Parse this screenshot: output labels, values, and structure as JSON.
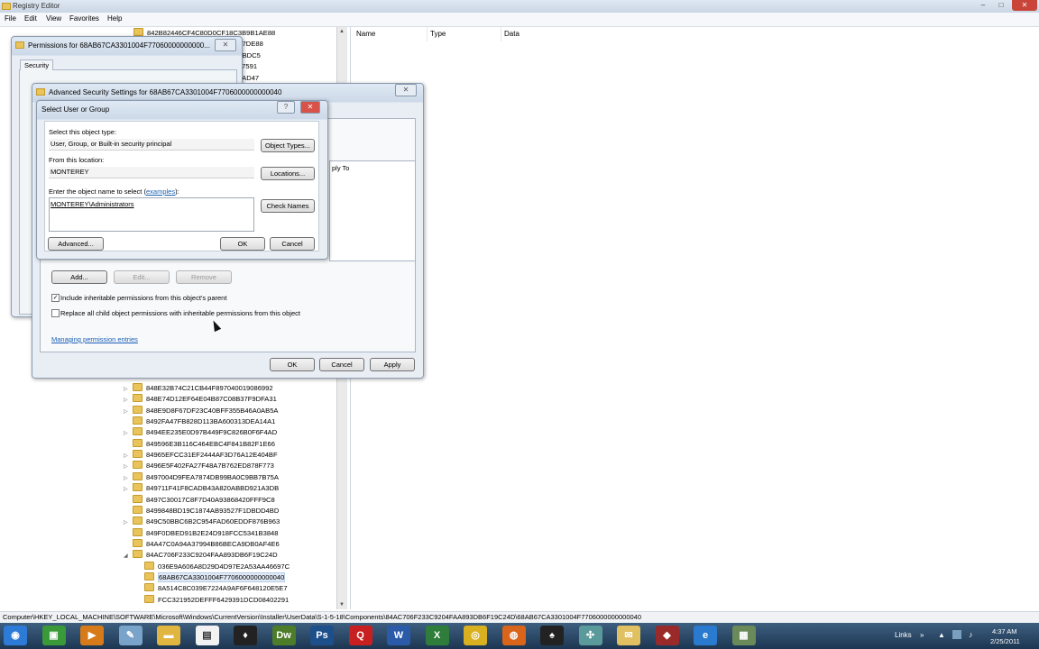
{
  "app": {
    "title": "Registry Editor",
    "controls": {
      "minimize": "–",
      "maximize": "□",
      "close": "✕"
    }
  },
  "menu": [
    "File",
    "Edit",
    "View",
    "Favorites",
    "Help"
  ],
  "tree": {
    "top_rows": [
      "842B82446CF4C80D0CF18C3B9B1AE88",
      "B47A7DE88",
      "BF2FBDC5",
      "024C7591",
      "BF13AD47"
    ],
    "rows": [
      {
        "label": "848E32B74C21CB44F897040019086992",
        "expandable": true,
        "indent": 0
      },
      {
        "label": "848E74D12EF64E04B87C08B37F9DFA31",
        "expandable": true,
        "indent": 0
      },
      {
        "label": "848E9D8F67DF23C40BFF355B46A0AB5A",
        "expandable": true,
        "indent": 0
      },
      {
        "label": "8492FA47FB828D113BA600313DEA14A1",
        "expandable": false,
        "indent": 0
      },
      {
        "label": "8494EE235E0D97B449F9C826B0F6F4AD",
        "expandable": true,
        "indent": 0
      },
      {
        "label": "849596E3B116C464EBC4F841B82F1E66",
        "expandable": false,
        "indent": 0
      },
      {
        "label": "84965EFCC31EF2444AF3D76A12E404BF",
        "expandable": true,
        "indent": 0
      },
      {
        "label": "8496E5F402FA27F48A7B762ED878F773",
        "expandable": true,
        "indent": 0
      },
      {
        "label": "8497004D9FEA7874DB99BA0C9BB7B75A",
        "expandable": true,
        "indent": 0
      },
      {
        "label": "849711F41F8CADB43A820ABBD921A3DB",
        "expandable": true,
        "indent": 0
      },
      {
        "label": "8497C30017C8F7D40A93868420FFF9C8",
        "expandable": false,
        "indent": 0
      },
      {
        "label": "8499848BD19C1874AB93527F1DBDD4BD",
        "expandable": false,
        "indent": 0
      },
      {
        "label": "849C50BBC6B2C954FAD60EDDF876B963",
        "expandable": true,
        "indent": 0
      },
      {
        "label": "849F0DBED91B2E24D918FCC5341B3848",
        "expandable": false,
        "indent": 0
      },
      {
        "label": "84A47C0A94A37994B86BECA9DB0AF4E6",
        "expandable": false,
        "indent": 0
      },
      {
        "label": "84AC706F233C9204FAA893DB6F19C24D",
        "expandable": true,
        "indent": 0,
        "expanded": true
      },
      {
        "label": "036E9A606A8D29D4D97E2A53AA46697C",
        "expandable": false,
        "indent": 1
      },
      {
        "label": "68AB67CA3301004F7706000000000040",
        "expandable": false,
        "indent": 1,
        "selected": true
      },
      {
        "label": "8A514C8C039E7224A9AF6F648120E5E7",
        "expandable": false,
        "indent": 1
      },
      {
        "label": "FCC321952DEFFF6429391DCD08402291",
        "expandable": false,
        "indent": 1
      }
    ]
  },
  "right_pane": {
    "columns": [
      "Name",
      "Type",
      "Data"
    ]
  },
  "status_bar": "Computer\\HKEY_LOCAL_MACHINE\\SOFTWARE\\Microsoft\\Windows\\CurrentVersion\\Installer\\UserData\\S-1-5-18\\Components\\84AC706F233C9204FAA893DB6F19C24D\\68AB67CA3301004F7706000000000040",
  "permissions_dialog": {
    "title": "Permissions for 68AB67CA3301004F77060000000000...",
    "tab": "Security",
    "close": "✕"
  },
  "advanced_dialog": {
    "title": "Advanced Security Settings for 68AB67CA3301004F7706000000000040",
    "column_fragment": "ply To",
    "add": "Add...",
    "edit": "Edit...",
    "remove": "Remove",
    "include_inheritable": "Include inheritable permissions from this object's parent",
    "include_checked": "✓",
    "replace_child": "Replace all child object permissions with inheritable permissions from this object",
    "managing_link": "Managing permission entries",
    "ok": "OK",
    "cancel": "Cancel",
    "apply": "Apply",
    "close": "✕"
  },
  "select_dialog": {
    "title": "Select User or Group",
    "help": "?",
    "close": "✕",
    "object_type_label": "Select this object type:",
    "object_type_value": "User, Group, or Built-in security principal",
    "object_types_button": "Object Types...",
    "location_label": "From this location:",
    "location_value": "MONTEREY",
    "locations_button": "Locations...",
    "enter_label_prefix": "Enter the object name to select (",
    "enter_label_link": "examples",
    "enter_label_suffix": "):",
    "object_name": "MONTEREY\\Administrators",
    "check_names_button": "Check Names",
    "advanced_button": "Advanced...",
    "ok": "OK",
    "cancel": "Cancel"
  },
  "taskbar": {
    "icons": [
      {
        "name": "start-orb-icon",
        "glyph": "◉",
        "color": "#2d7bd6"
      },
      {
        "name": "terminal-icon",
        "glyph": "▣",
        "color": "#3a9a3a"
      },
      {
        "name": "media-player-icon",
        "glyph": "▶",
        "color": "#d67a1a"
      },
      {
        "name": "notepad-icon",
        "glyph": "✎",
        "color": "#7aa3c9"
      },
      {
        "name": "folder-icon",
        "glyph": "▬",
        "color": "#e0b640"
      },
      {
        "name": "document-icon",
        "glyph": "▤",
        "color": "#f2f2f2"
      },
      {
        "name": "hat-icon",
        "glyph": "♦",
        "color": "#222222"
      },
      {
        "name": "dreamweaver-icon",
        "glyph": "Dw",
        "color": "#4e7d2a"
      },
      {
        "name": "photoshop-icon",
        "glyph": "Ps",
        "color": "#1d4f8a"
      },
      {
        "name": "q-app-icon",
        "glyph": "Q",
        "color": "#c82020"
      },
      {
        "name": "word-icon",
        "glyph": "W",
        "color": "#2a5aa8"
      },
      {
        "name": "excel-icon",
        "glyph": "X",
        "color": "#2e7d3a"
      },
      {
        "name": "chrome-icon",
        "glyph": "◎",
        "color": "#d9b020"
      },
      {
        "name": "firefox-icon",
        "glyph": "◍",
        "color": "#d9651a"
      },
      {
        "name": "flash-icon",
        "glyph": "♠",
        "color": "#222222"
      },
      {
        "name": "network-icon",
        "glyph": "✣",
        "color": "#5a9a9a"
      },
      {
        "name": "mail-icon",
        "glyph": "✉",
        "color": "#e0c060"
      },
      {
        "name": "registry-icon",
        "glyph": "◆",
        "color": "#9a2a2a"
      },
      {
        "name": "ie-icon",
        "glyph": "e",
        "color": "#2a7ad0"
      },
      {
        "name": "remote-icon",
        "glyph": "▦",
        "color": "#6a8a5a"
      }
    ],
    "links_label": "Links",
    "clock_time": "4:37 AM",
    "clock_date": "2/25/2011"
  }
}
